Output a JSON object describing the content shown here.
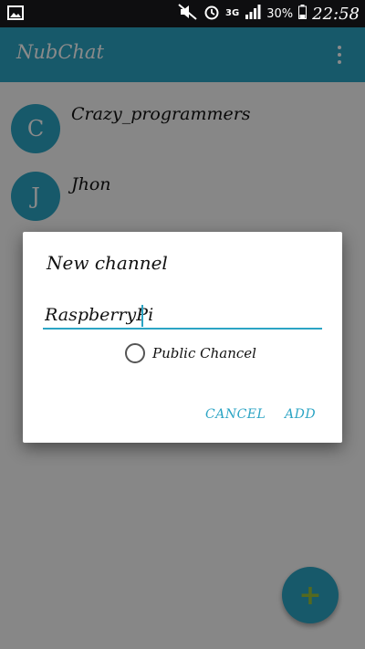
{
  "status_bar": {
    "network": "3G",
    "battery": "30%",
    "time": "22:58"
  },
  "app_bar": {
    "title": "NubChat"
  },
  "channels": [
    {
      "initial": "C",
      "name": "Crazy_programmers"
    },
    {
      "initial": "J",
      "name": "Jhon"
    }
  ],
  "dialog": {
    "title": "New channel",
    "input_value": "RaspberryPi",
    "checkbox_label": "Public Chancel",
    "checkbox_checked": false,
    "cancel_label": "CANCEL",
    "add_label": "ADD"
  },
  "fab": {
    "icon": "plus-icon",
    "glyph": "+"
  },
  "colors": {
    "accent": "#2ba4c4",
    "fab_icon": "#9cc23a"
  }
}
